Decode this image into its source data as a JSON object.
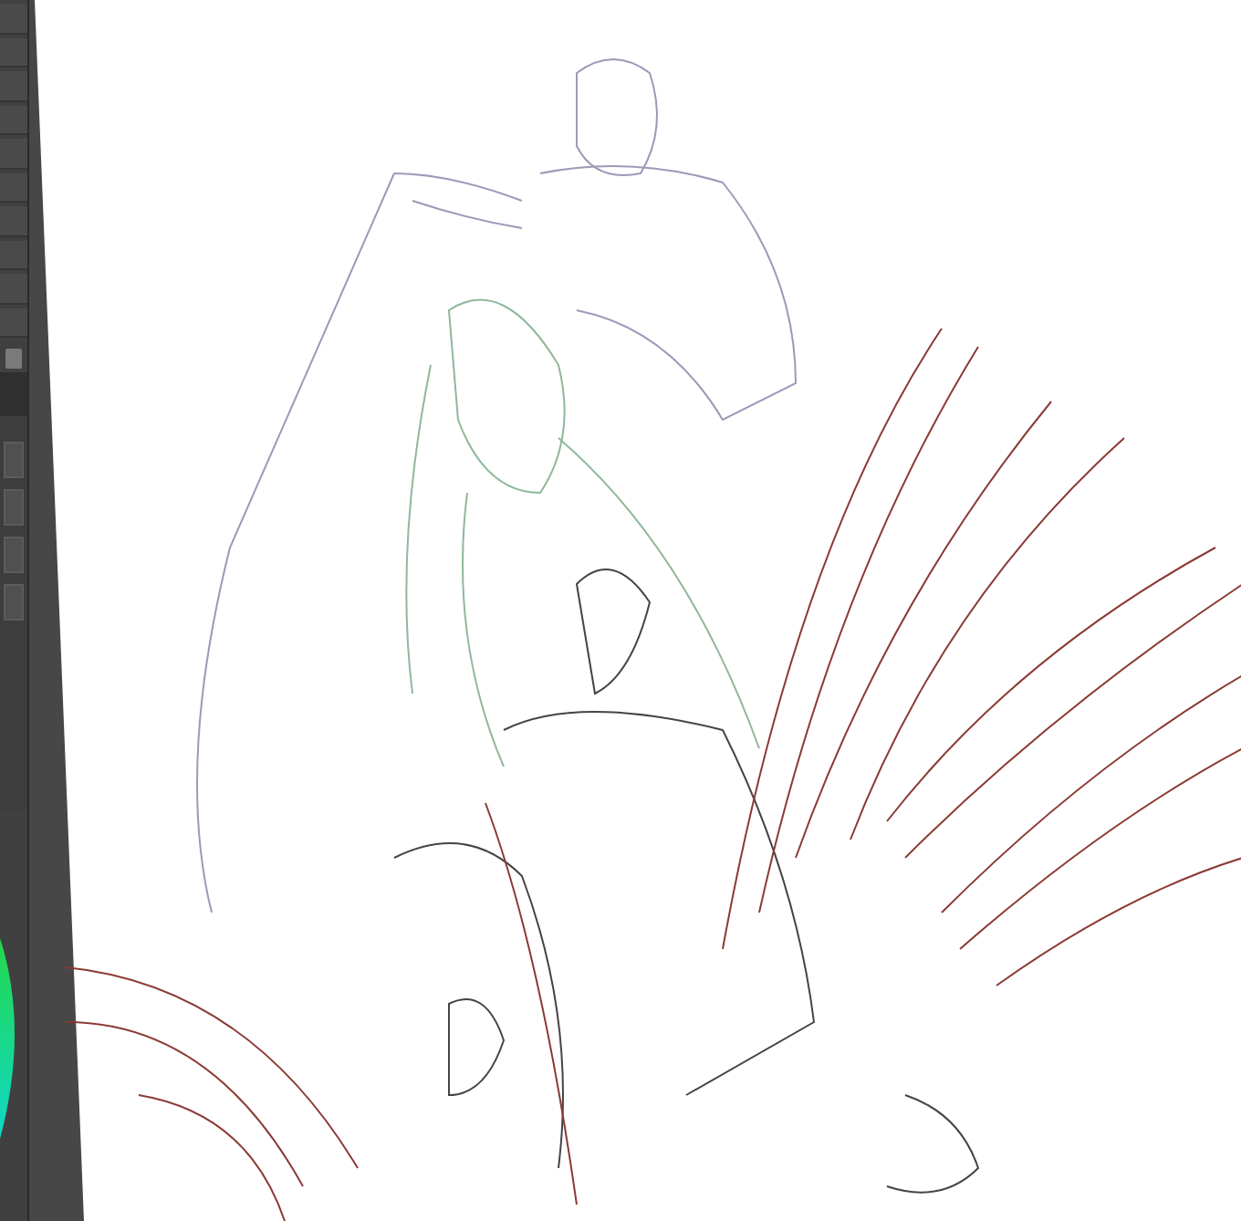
{
  "panels": [
    {
      "kind": "layer-list"
    },
    {
      "kind": "tool-property"
    },
    {
      "kind": "color-wheel"
    }
  ],
  "canvas": {
    "kind": "line-art"
  }
}
